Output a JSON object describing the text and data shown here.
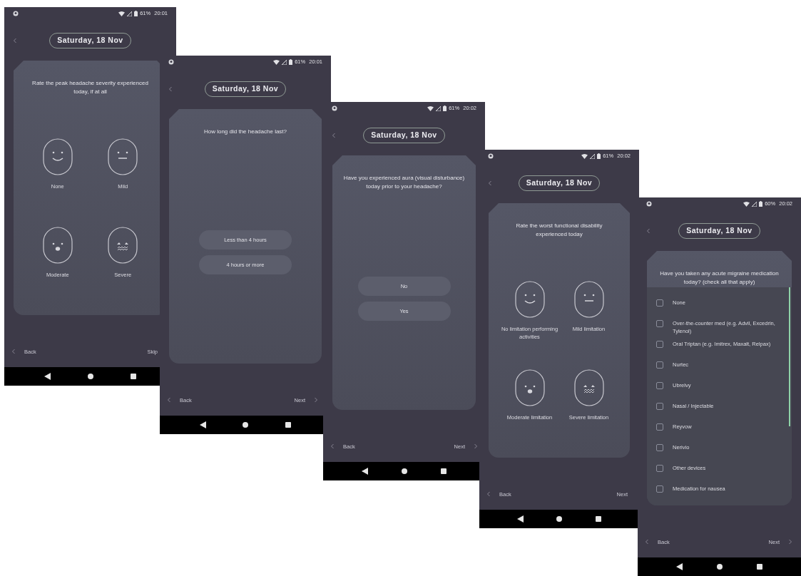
{
  "screens": [
    {
      "status": {
        "battery": "61%",
        "time": "20:01"
      },
      "date": "Saturday, 18 Nov",
      "card": {
        "kind": "faces",
        "question": "Rate the peak headache severity experienced today, if at all",
        "items": [
          {
            "kind": "happy",
            "label": "None",
            "selected": false
          },
          {
            "kind": "neutral",
            "label": "Mild",
            "selected": false
          },
          {
            "kind": "surprised",
            "label": "Moderate",
            "selected": false
          },
          {
            "kind": "distressed",
            "label": "Severe",
            "selected": false
          }
        ]
      },
      "footer": {
        "back": "Back",
        "forward": "Skip",
        "forward_chevron": false
      }
    },
    {
      "status": {
        "battery": "61%",
        "time": "20:01"
      },
      "date": "Saturday, 18 Nov",
      "card": {
        "kind": "options",
        "question": "How long did the headache last?",
        "items": [
          {
            "label": "Less than 4 hours",
            "selected": false
          },
          {
            "label": "4 hours or more",
            "selected": false
          }
        ]
      },
      "footer": {
        "back": "Back",
        "forward": "Next",
        "forward_chevron": true
      }
    },
    {
      "status": {
        "battery": "61%",
        "time": "20:02"
      },
      "date": "Saturday, 18 Nov",
      "card": {
        "kind": "options",
        "question": "Have you experienced aura (visual disturbance) today prior to your headache?",
        "items": [
          {
            "label": "No",
            "selected": false
          },
          {
            "label": "Yes",
            "selected": false
          }
        ]
      },
      "footer": {
        "back": "Back",
        "forward": "Next",
        "forward_chevron": true
      }
    },
    {
      "status": {
        "battery": "61%",
        "time": "20:02"
      },
      "date": "Saturday, 18 Nov",
      "card": {
        "kind": "faces",
        "question": "Rate the worst functional disability experienced today",
        "items": [
          {
            "kind": "happy",
            "label": "No limitation performing activities",
            "selected": false
          },
          {
            "kind": "neutral",
            "label": "Mild limitation",
            "selected": false
          },
          {
            "kind": "surprised",
            "label": "Moderate limitation",
            "selected": false
          },
          {
            "kind": "distressed",
            "label": "Severe limitation",
            "selected": false
          }
        ]
      },
      "footer": {
        "back": "Back",
        "forward": "Next",
        "forward_chevron": false
      }
    },
    {
      "status": {
        "battery": "60%",
        "time": "20:02"
      },
      "date": "Saturday, 18 Nov",
      "card": {
        "kind": "checklist",
        "question": "Have you taken any acute migraine medication today? (check all that apply)",
        "items": [
          {
            "label": "None",
            "checked": false
          },
          {
            "label": "Over-the-counter med (e.g. Advil, Excedrin, Tylenol)",
            "checked": false
          },
          {
            "label": "Oral Triptan (e.g. Imitrex, Maxalt, Relpax)",
            "checked": false
          },
          {
            "label": "Nurtec",
            "checked": false
          },
          {
            "label": "Ubrelvy",
            "checked": false
          },
          {
            "label": "Nasal / Injectable",
            "checked": false
          },
          {
            "label": "Reyvow",
            "checked": false
          },
          {
            "label": "Nerivio",
            "checked": false
          },
          {
            "label": "Other devices",
            "checked": false
          },
          {
            "label": "Medication for nausea",
            "checked": false
          }
        ]
      },
      "footer": {
        "back": "Back",
        "forward": "Next",
        "forward_chevron": true
      }
    }
  ]
}
